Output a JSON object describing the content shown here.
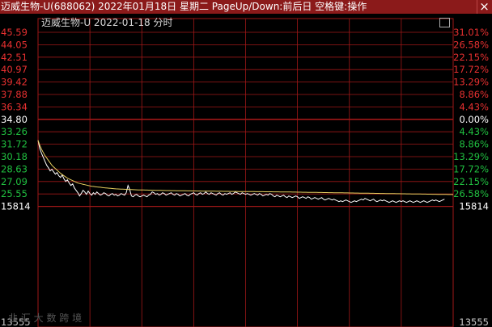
{
  "window": {
    "title": "迈威生物-U(688062) 2022年01月18日 星期二 PageUp/Down:前后日 空格键:操作",
    "close_glyph": "×"
  },
  "header": {
    "stock_label": "迈威生物-U  2022-01-18 分时"
  },
  "colors": {
    "title_bg": "#8b1a1a",
    "grid": "#a01818",
    "up": "#e83030",
    "down": "#20c040",
    "flat": "#ffffff",
    "price_line": "#ffffff",
    "avg_line": "#e8d060"
  },
  "watermark": "韭 汇 大 数 跨 境",
  "chart_data": {
    "type": "line",
    "title": "迈威生物-U  2022-01-18 分时",
    "price_ticks": [
      "45.59",
      "44.05",
      "42.51",
      "40.97",
      "39.42",
      "37.88",
      "36.34",
      "34.80",
      "33.26",
      "31.72",
      "30.18",
      "28.63",
      "27.09",
      "25.55"
    ],
    "pct_ticks": [
      "31.01%",
      "26.58%",
      "22.15%",
      "17.72%",
      "13.29%",
      "8.86%",
      "4.43%",
      "0.00%",
      "4.43%",
      "8.86%",
      "13.29%",
      "17.72%",
      "22.15%",
      "26.58%"
    ],
    "volume_ticks": {
      "left": "15814",
      "right": "15814"
    },
    "bottom_labels": {
      "left": "13555",
      "right": "13555"
    },
    "prev_close": 34.8,
    "ylim": [
      24.01,
      47.13
    ],
    "x_range": [
      0,
      240
    ],
    "series": [
      {
        "values": [
          32.2,
          31.2,
          30.6,
          30.1,
          29.6,
          29.1,
          28.8,
          28.4,
          28.6,
          28.3,
          28.0,
          28.2,
          27.8,
          27.6,
          27.9,
          27.4,
          27.1,
          27.3,
          26.9,
          26.6,
          26.8,
          26.3,
          26.0,
          25.7,
          25.3,
          25.6,
          26.0,
          25.8,
          25.5,
          25.9,
          25.6,
          25.4,
          25.7,
          25.5,
          25.8,
          25.6,
          25.4,
          25.5,
          25.7,
          25.6,
          25.4,
          25.3,
          25.5,
          25.6,
          25.4,
          25.5,
          25.3,
          25.4,
          25.6,
          25.5,
          25.4,
          25.7,
          26.6,
          26.1,
          25.3,
          25.2,
          25.4,
          25.5,
          25.3,
          25.2,
          25.3,
          25.4,
          25.3,
          25.2,
          25.4,
          25.5,
          25.8,
          25.7,
          25.5,
          25.6,
          25.4,
          25.5,
          25.7,
          25.6,
          25.4,
          25.5,
          25.6,
          25.7,
          25.5,
          25.4,
          25.6,
          25.5,
          25.3,
          25.4,
          25.5,
          25.6,
          25.4,
          25.3,
          25.5,
          25.6,
          25.7,
          25.5,
          25.4,
          25.6,
          25.7,
          25.5,
          25.6,
          25.8,
          25.6,
          25.5,
          25.7,
          25.6,
          25.5,
          25.4,
          25.6,
          25.7,
          25.5,
          25.4,
          25.6,
          25.5,
          25.6,
          25.7,
          25.5,
          25.6,
          25.8,
          25.7,
          25.6,
          25.5,
          25.7,
          25.6,
          25.5,
          25.6,
          25.5,
          25.4,
          25.5,
          25.6,
          25.5,
          25.4,
          25.6,
          25.5,
          25.3,
          25.4,
          25.5,
          25.4,
          25.6,
          25.5,
          25.3,
          25.2,
          25.4,
          25.3,
          25.2,
          25.3,
          25.4,
          25.2,
          25.1,
          25.3,
          25.2,
          25.1,
          25.2,
          25.3,
          25.2,
          25.0,
          25.1,
          25.2,
          25.1,
          25.0,
          25.2,
          25.1,
          24.9,
          25.0,
          25.1,
          25.0,
          24.9,
          25.0,
          25.1,
          24.9,
          24.8,
          24.9,
          25.0,
          24.9,
          24.8,
          24.9,
          24.8,
          24.7,
          24.6,
          24.7,
          24.6,
          24.7,
          24.8,
          24.7,
          24.6,
          24.5,
          24.6,
          24.7,
          24.6,
          24.7,
          24.8,
          24.9,
          24.8,
          25.0,
          24.9,
          24.8,
          24.7,
          24.8,
          24.9,
          24.7,
          24.6,
          24.7,
          24.8,
          24.7,
          24.8,
          24.7,
          24.6,
          24.5,
          24.6,
          24.7,
          24.6,
          24.5,
          24.6,
          24.7,
          24.6,
          24.7,
          24.6,
          24.5,
          24.6,
          24.7,
          24.6,
          24.5,
          24.6,
          24.7,
          24.6,
          24.5,
          24.6,
          24.7,
          24.6,
          24.5,
          24.6,
          24.7,
          24.8,
          24.7,
          24.8,
          24.7,
          24.6,
          24.7,
          24.8,
          24.9
        ]
      },
      {
        "values": [
          32.2,
          31.6,
          31.1,
          30.7,
          30.3,
          30.0,
          29.7,
          29.4,
          29.1,
          28.9,
          28.7,
          28.5,
          28.3,
          28.1,
          27.95,
          27.8,
          27.65,
          27.5,
          27.4,
          27.3,
          27.2,
          27.1,
          27.0,
          26.9,
          26.85,
          26.8,
          26.75,
          26.7,
          26.65,
          26.6,
          26.55,
          26.5,
          26.48,
          26.45,
          26.42,
          26.4,
          26.38,
          26.35,
          26.32,
          26.3,
          26.28,
          26.26,
          26.24,
          26.22,
          26.2,
          26.18,
          26.17,
          26.16,
          26.15,
          26.14,
          26.13,
          26.12,
          26.11,
          26.1,
          26.09,
          26.08,
          26.07,
          26.06,
          26.05,
          26.05,
          26.04,
          26.04,
          26.03,
          26.03,
          26.02,
          26.02,
          26.01,
          26.01,
          26.0,
          26.0,
          25.99,
          25.99,
          25.98,
          25.98,
          25.97,
          25.97,
          25.97,
          25.96,
          25.96,
          25.96,
          25.95,
          25.95,
          25.95,
          25.94,
          25.94,
          25.94,
          25.93,
          25.93,
          25.93,
          25.92,
          25.92,
          25.92,
          25.91,
          25.91,
          25.91,
          25.9,
          25.9,
          25.9,
          25.9,
          25.89,
          25.89,
          25.89,
          25.89,
          25.88,
          25.88,
          25.88,
          25.88,
          25.87,
          25.87,
          25.87,
          25.87,
          25.86,
          25.86,
          25.86,
          25.86,
          25.86,
          25.85,
          25.85,
          25.85,
          25.85,
          25.85,
          25.84,
          25.84,
          25.84,
          25.84,
          25.84,
          25.83,
          25.83,
          25.83,
          25.83,
          25.83,
          25.82,
          25.82,
          25.82,
          25.82,
          25.82,
          25.81,
          25.81,
          25.81,
          25.81,
          25.8,
          25.8,
          25.8,
          25.8,
          25.79,
          25.79,
          25.79,
          25.78,
          25.78,
          25.78,
          25.77,
          25.77,
          25.77,
          25.76,
          25.76,
          25.76,
          25.75,
          25.75,
          25.75,
          25.74,
          25.74,
          25.74,
          25.73,
          25.73,
          25.73,
          25.72,
          25.72,
          25.72,
          25.71,
          25.71,
          25.71,
          25.7,
          25.7,
          25.7,
          25.69,
          25.69,
          25.69,
          25.68,
          25.68,
          25.68,
          25.67,
          25.67,
          25.67,
          25.66,
          25.66,
          25.66,
          25.65,
          25.65,
          25.65,
          25.64,
          25.64,
          25.64,
          25.63,
          25.63,
          25.63,
          25.62,
          25.62,
          25.62,
          25.61,
          25.61,
          25.61,
          25.6,
          25.6,
          25.6,
          25.59,
          25.59,
          25.59,
          25.58,
          25.58,
          25.58,
          25.57,
          25.57,
          25.57,
          25.56,
          25.56,
          25.56,
          25.55,
          25.55,
          25.55,
          25.54,
          25.54,
          25.54,
          25.53,
          25.53,
          25.53,
          25.52,
          25.52,
          25.52,
          25.51,
          25.51,
          25.51,
          25.5,
          25.5,
          25.5,
          25.49,
          25.49,
          25.49,
          25.48,
          25.48,
          25.48,
          25.47
        ]
      }
    ],
    "grid": true
  }
}
